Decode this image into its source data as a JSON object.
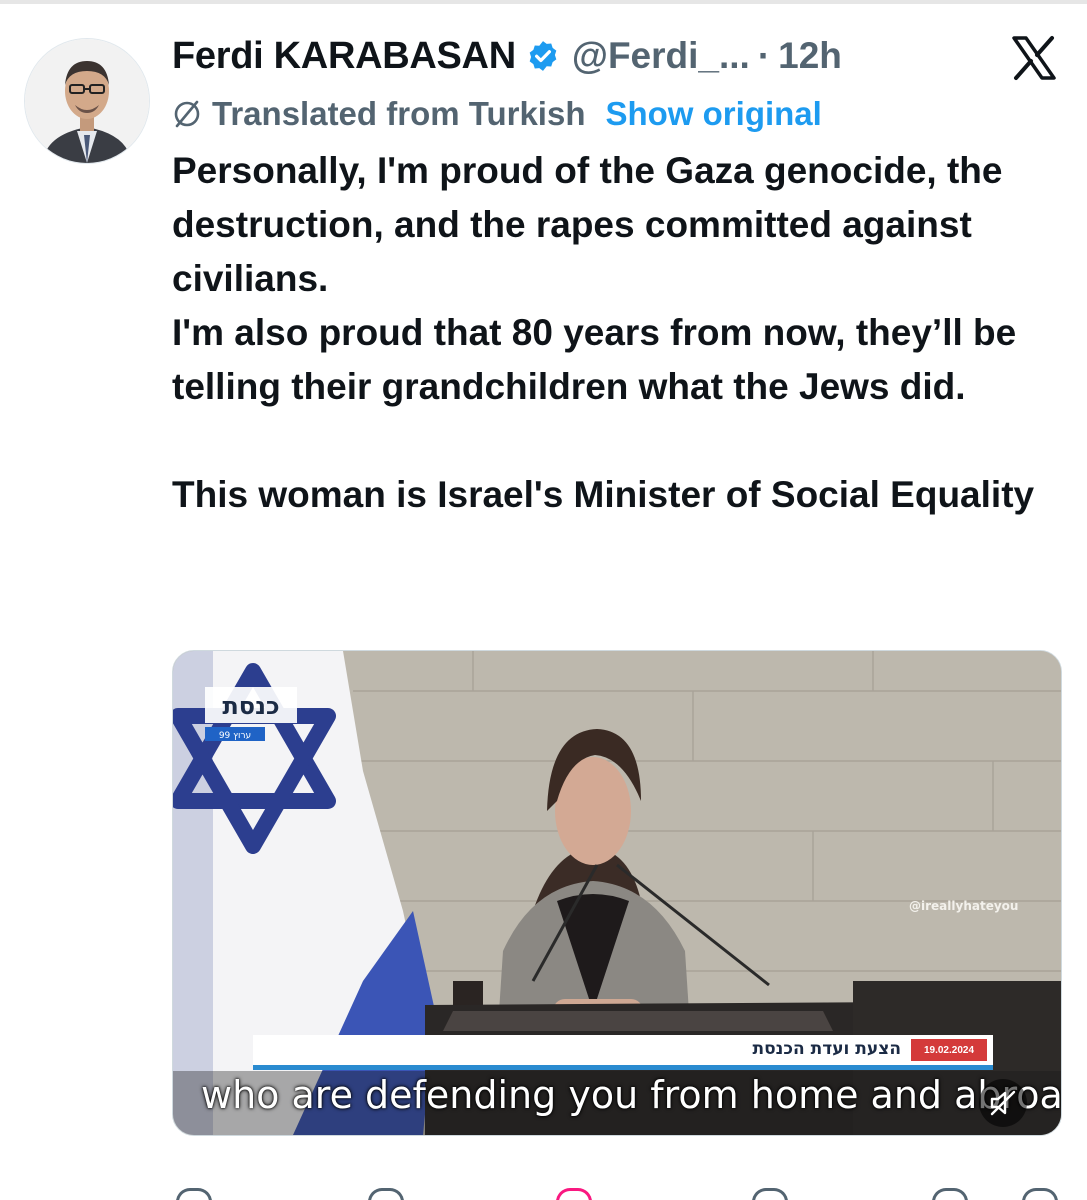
{
  "tweet": {
    "author_name": "Ferdi KARABASAN",
    "handle": "@Ferdi_...",
    "separator": "·",
    "time": "12h",
    "translated_label": "Translated from Turkish",
    "show_original_label": "Show original",
    "paragraphs": [
      "Personally, I'm proud of the Gaza genocide, the destruction, and the rapes committed against civilians.",
      "I'm also proud that 80 years from now, they’ll be telling their grandchildren what the Jews did.",
      "This woman is Israel's Minister of Social Equality"
    ]
  },
  "media": {
    "caption": "who are defending you from home and abroad",
    "watermark": "@ireallyhateyou",
    "lower_bar_title": "הצעת ועדת הכנסת",
    "lower_bar_date": "19.02.2024",
    "channel_logo": "כנסת",
    "channel_sublabel": "ערוץ 99"
  },
  "colors": {
    "accent": "#1d9bf0",
    "secondary_text": "#536471",
    "like": "#f91880"
  },
  "icons": {
    "verified": "verified-badge-icon",
    "logo": "x-logo-icon",
    "translate": "globe-slash-icon",
    "mute": "speaker-muted-icon"
  }
}
